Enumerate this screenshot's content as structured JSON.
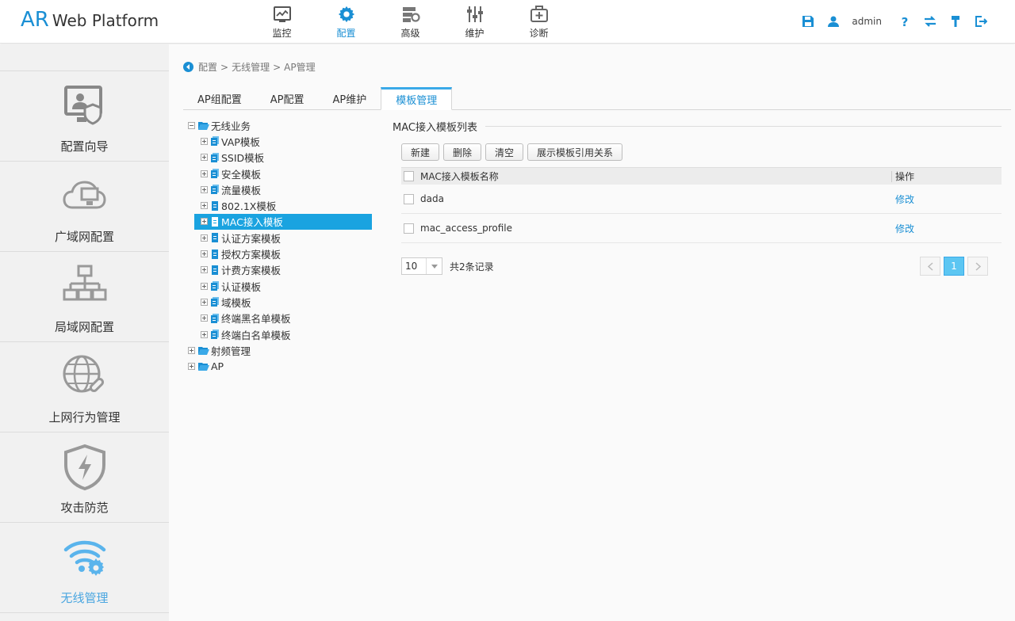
{
  "header": {
    "logo_ar": "AR",
    "logo_text": "Web Platform",
    "nav": [
      {
        "label": "监控",
        "icon": "monitor-icon",
        "active": false
      },
      {
        "label": "配置",
        "icon": "gear-icon",
        "active": true
      },
      {
        "label": "高级",
        "icon": "advanced-icon",
        "active": false
      },
      {
        "label": "维护",
        "icon": "sliders-icon",
        "active": false
      },
      {
        "label": "诊断",
        "icon": "medkit-icon",
        "active": false
      }
    ],
    "user": "admin"
  },
  "sidebar": {
    "items": [
      {
        "label": "配置向导",
        "icon": "config-wizard-icon"
      },
      {
        "label": "广域网配置",
        "icon": "wan-cloud-icon"
      },
      {
        "label": "局域网配置",
        "icon": "lan-network-icon"
      },
      {
        "label": "上网行为管理",
        "icon": "internet-behavior-icon"
      },
      {
        "label": "攻击防范",
        "icon": "shield-lightning-icon"
      },
      {
        "label": "无线管理",
        "icon": "wireless-gear-icon",
        "active": true
      }
    ]
  },
  "breadcrumb": {
    "items": [
      "配置",
      "无线管理",
      "AP管理"
    ],
    "separator": ">"
  },
  "tabs": [
    {
      "label": "AP组配置"
    },
    {
      "label": "AP配置"
    },
    {
      "label": "AP维护"
    },
    {
      "label": "模板管理",
      "active": true
    }
  ],
  "tree": {
    "root": "无线业务",
    "children": [
      "VAP模板",
      "SSID模板",
      "安全模板",
      "流量模板",
      "802.1X模板",
      "MAC接入模板",
      "认证方案模板",
      "授权方案模板",
      "计费方案模板",
      "认证模板",
      "域模板",
      "终端黑名单模板",
      "终端白名单模板"
    ],
    "selected_index": 5,
    "other_roots": [
      "射频管理",
      "AP"
    ]
  },
  "panel": {
    "title": "MAC接入模板列表",
    "buttons": [
      "新建",
      "删除",
      "清空",
      "展示模板引用关系"
    ],
    "columns": [
      "MAC接入模板名称",
      "操作"
    ],
    "rows": [
      {
        "name": "dada",
        "action": "修改"
      },
      {
        "name": "mac_access_profile",
        "action": "修改"
      }
    ],
    "page_size": "10",
    "records_text": "共2条记录",
    "current_page": "1"
  },
  "colors": {
    "accent": "#1a8fd4",
    "selected_bg": "#1aa3e0",
    "active_page": "#5cc6f2"
  }
}
